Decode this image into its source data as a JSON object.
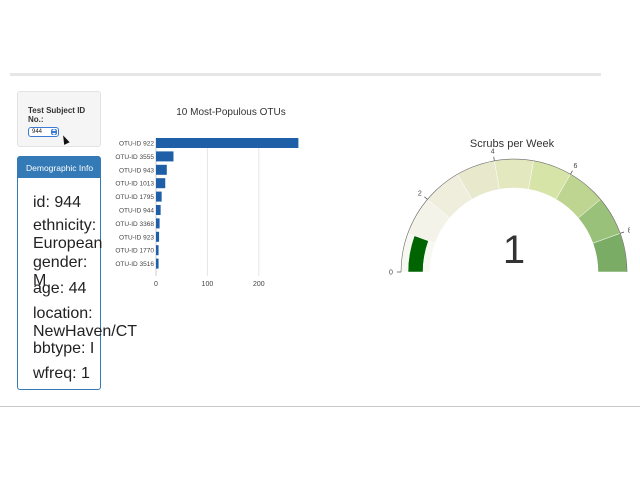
{
  "selector": {
    "label": "Test Subject ID No.:",
    "selected": "944"
  },
  "demographics": {
    "heading": "Demographic Info",
    "lines": [
      "id: 944",
      "ethnicity: European",
      "gender: M",
      "age: 44",
      "location: NewHaven/CT",
      "bbtype: I",
      "wfreq: 1"
    ]
  },
  "chart_data": [
    {
      "type": "bar",
      "orientation": "horizontal",
      "title": "10 Most-Populous OTUs",
      "categories": [
        "OTU-ID 922",
        "OTU-ID 3555",
        "OTU-ID 943",
        "OTU-ID 1013",
        "OTU-ID 1795",
        "OTU-ID 944",
        "OTU-ID 3368",
        "OTU-ID 923",
        "OTU-ID 1770",
        "OTU-ID 3516"
      ],
      "values": [
        277,
        34,
        21,
        18,
        11,
        9,
        7,
        6,
        5,
        5
      ],
      "xlim": [
        0,
        280
      ],
      "xticks": [
        0,
        100,
        200
      ],
      "grid": true,
      "color": "#1f5fa8"
    },
    {
      "type": "gauge",
      "title": "Scrubs per Week",
      "value": 1,
      "range": [
        0,
        9
      ],
      "ticks": [
        "0",
        "2",
        "4",
        "6",
        "8"
      ],
      "bar_color": "#006400",
      "step_colors": [
        "#f8f8f2",
        "#f4f3e9",
        "#efeedd",
        "#e8e8cd",
        "#e3e8bf",
        "#d6e4a8",
        "#bdd591",
        "#9ac17a",
        "#7bac66"
      ]
    }
  ]
}
